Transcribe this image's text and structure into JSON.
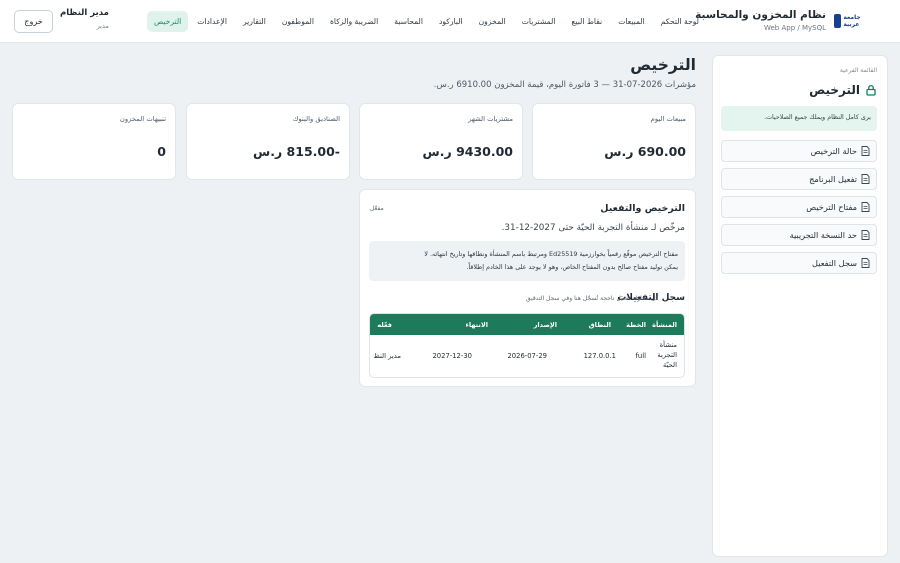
{
  "header": {
    "brand_title": "نظام المخزون والمحاسبة",
    "brand_subtitle": "Web App / MySQL",
    "logo_text": "جامعة عربية",
    "nav": [
      {
        "label": "لوحة التحكم",
        "active": false
      },
      {
        "label": "المبيعات",
        "active": false
      },
      {
        "label": "نقاط البيع",
        "active": false
      },
      {
        "label": "المشتريات",
        "active": false
      },
      {
        "label": "المخزون",
        "active": false
      },
      {
        "label": "الباركود",
        "active": false
      },
      {
        "label": "المحاسبة",
        "active": false
      },
      {
        "label": "الضريبة والزكاة",
        "active": false
      },
      {
        "label": "الموظفون",
        "active": false
      },
      {
        "label": "التقارير",
        "active": false
      },
      {
        "label": "الإعدادات",
        "active": false
      },
      {
        "label": "الترخيص",
        "active": true
      }
    ],
    "user_name": "مدير النظام",
    "user_role": "مدير",
    "logout_label": "خروج"
  },
  "sidebar": {
    "menu_label": "القائمة الفرعية",
    "title": "الترخيص",
    "note": "يرى كامل النظام ويملك جميع الصلاحيات.",
    "items": [
      {
        "label": "حالة الترخيص"
      },
      {
        "label": "تفعيل البرنامج"
      },
      {
        "label": "مفتاح الترخيص"
      },
      {
        "label": "حد النسخة التجريبية"
      },
      {
        "label": "سجل التفعيل"
      }
    ]
  },
  "page": {
    "title": "الترخيص",
    "subtitle": "مؤشرات 2026-07-31 — 3 فاتورة اليوم، قيمة المخزون 6910.00 ر.س."
  },
  "stats": [
    {
      "label": "مبيعات اليوم",
      "value": "690.00 ر.س"
    },
    {
      "label": "مشتريات الشهر",
      "value": "9430.00 ر.س"
    },
    {
      "label": "الصناديق والبنوك",
      "value": "-815.00 ر.س"
    },
    {
      "label": "تنبيهات المخزون",
      "value": "0"
    }
  ],
  "license": {
    "title": "الترخيص والتفعيل",
    "badge": "مفعّل",
    "licensed_text": "مرخّص لـ منشأة التجربة الحيّة حتى 2027-12-31.",
    "info_line1": "مفتاح الترخيص موقّع رقمياً بخوارزمية Ed25519 ومرتبط باسم المنشأة ونطاقها وتاريخ انتهائه. لا",
    "info_line2": "يمكن توليد مفتاح صالح بدون المفتاح الخاص، وهو لا يوجد على هذا الخادم إطلاقاً.",
    "log_title": "سجل التفعيلات",
    "log_note": "كل محاولة تفعيل ناجحة تُسجّل هنا وفي سجل التدقيق",
    "table": {
      "headers": [
        "المنشأة",
        "الخطة",
        "النطاق",
        "الإصدار",
        "الانتهاء",
        "فعّله"
      ],
      "row": {
        "org_line1": "منشأة",
        "org_line2": "التجربة",
        "org_line3": "الحيّة",
        "plan": "full",
        "domain": "127.0.0.1",
        "issued": "2026-07-29",
        "expires": "2027-12-30",
        "by": "مدير النظ"
      }
    }
  }
}
